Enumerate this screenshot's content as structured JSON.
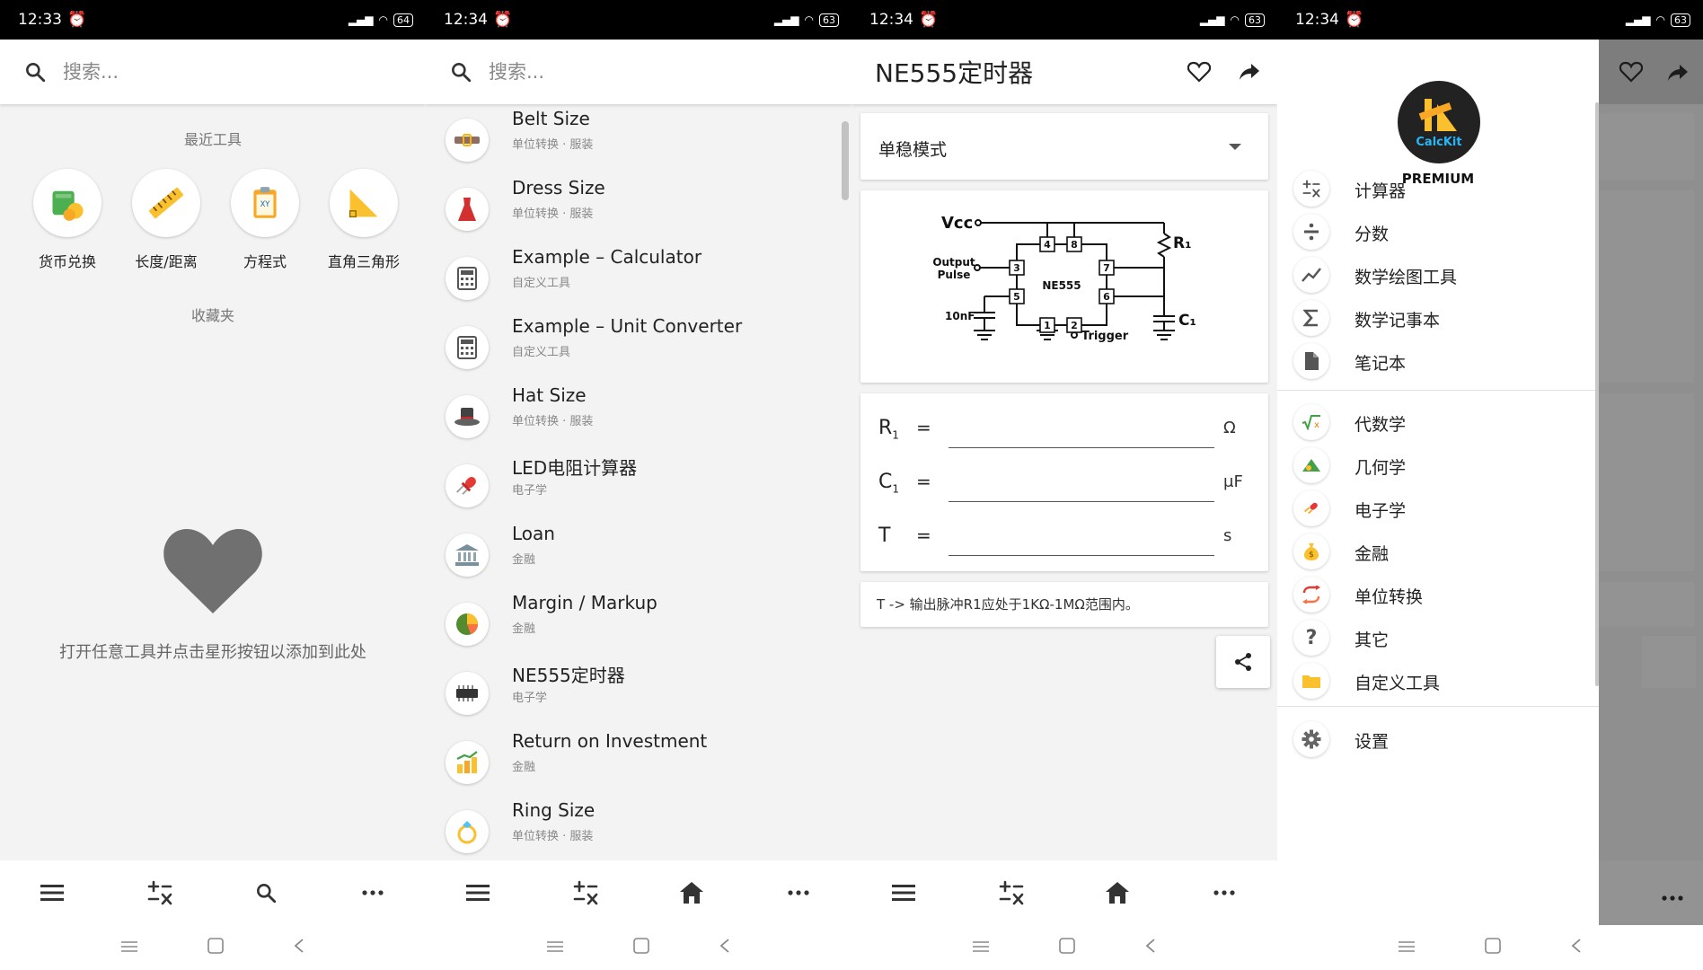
{
  "status": {
    "s1": {
      "time": "12:33",
      "battery": "64"
    },
    "s2": {
      "time": "12:34",
      "battery": "63"
    },
    "s3": {
      "time": "12:34",
      "battery": "63"
    },
    "s4": {
      "time": "12:34",
      "battery": "63"
    }
  },
  "search": {
    "placeholder": "搜索..."
  },
  "home": {
    "recent_title": "最近工具",
    "recent": [
      {
        "label": "货币兑换",
        "icon": "money-bag-icon"
      },
      {
        "label": "长度/距离",
        "icon": "ruler-icon"
      },
      {
        "label": "方程式",
        "icon": "clipboard-xy-icon"
      },
      {
        "label": "直角三角形",
        "icon": "right-triangle-icon"
      }
    ],
    "favorites_title": "收藏夹",
    "favorites_hint": "打开任意工具并点击星形按钮以添加到此处"
  },
  "tool_list": [
    {
      "title": "Belt Size",
      "subtitle": "单位转换 · 服装",
      "icon": "belt-icon"
    },
    {
      "title": "Dress Size",
      "subtitle": "单位转换 · 服装",
      "icon": "dress-icon"
    },
    {
      "title": "Example – Calculator",
      "subtitle": "自定义工具",
      "icon": "calculator-icon"
    },
    {
      "title": "Example – Unit Converter",
      "subtitle": "自定义工具",
      "icon": "calculator-icon"
    },
    {
      "title": "Hat Size",
      "subtitle": "单位转换 · 服装",
      "icon": "hat-icon"
    },
    {
      "title": "LED电阻计算器",
      "subtitle": "电子学",
      "icon": "led-icon"
    },
    {
      "title": "Loan",
      "subtitle": "金融",
      "icon": "bank-icon"
    },
    {
      "title": "Margin / Markup",
      "subtitle": "金融",
      "icon": "pie-chart-icon"
    },
    {
      "title": "NE555定时器",
      "subtitle": "电子学",
      "icon": "chip-icon"
    },
    {
      "title": "Return on Investment",
      "subtitle": "金融",
      "icon": "coins-growth-icon"
    },
    {
      "title": "Ring Size",
      "subtitle": "单位转换 · 服装",
      "icon": "ring-icon"
    }
  ],
  "ne555": {
    "title": "NE555定时器",
    "mode": "单稳模式",
    "circuit": {
      "vcc": "Vcc",
      "r1": "R₁",
      "c1": "C₁",
      "output_line1": "Output",
      "output_line2": "Pulse",
      "chip": "NE555",
      "cap": "10nF",
      "trigger": "Trigger",
      "pins": [
        "4",
        "8",
        "3",
        "7",
        "5",
        "6",
        "1",
        "2"
      ]
    },
    "fields": [
      {
        "label": "R",
        "sub": "1",
        "eq": "=",
        "value": "",
        "unit": "Ω"
      },
      {
        "label": "C",
        "sub": "1",
        "eq": "=",
        "value": "",
        "unit": "μF"
      },
      {
        "label": "T",
        "sub": "",
        "eq": "=",
        "value": "",
        "unit": "s"
      }
    ],
    "note": "T -> 输出脉冲R1应处于1KΩ-1MΩ范围内。"
  },
  "drawer": {
    "logo_text": "CalcKit",
    "premium": "PREMIUM",
    "group1": [
      {
        "label": "计算器",
        "icon": "calculator-ops-icon"
      },
      {
        "label": "分数",
        "icon": "divide-icon"
      },
      {
        "label": "数学绘图工具",
        "icon": "graph-line-icon"
      },
      {
        "label": "数学记事本",
        "icon": "sigma-icon"
      },
      {
        "label": "笔记本",
        "icon": "document-icon"
      }
    ],
    "group2": [
      {
        "label": "代数学",
        "icon": "sqrt-x-icon"
      },
      {
        "label": "几何学",
        "icon": "geometry-icon"
      },
      {
        "label": "电子学",
        "icon": "led-icon"
      },
      {
        "label": "金融",
        "icon": "money-bag-icon"
      },
      {
        "label": "单位转换",
        "icon": "convert-arrows-icon"
      },
      {
        "label": "其它",
        "icon": "question-icon"
      },
      {
        "label": "自定义工具",
        "icon": "folder-icon"
      }
    ],
    "settings": {
      "label": "设置",
      "icon": "gear-icon"
    }
  },
  "colors": {
    "accent": "#1a73e8",
    "icon_gray": "#555555",
    "drawer_scrim": "#8f8f8f"
  }
}
